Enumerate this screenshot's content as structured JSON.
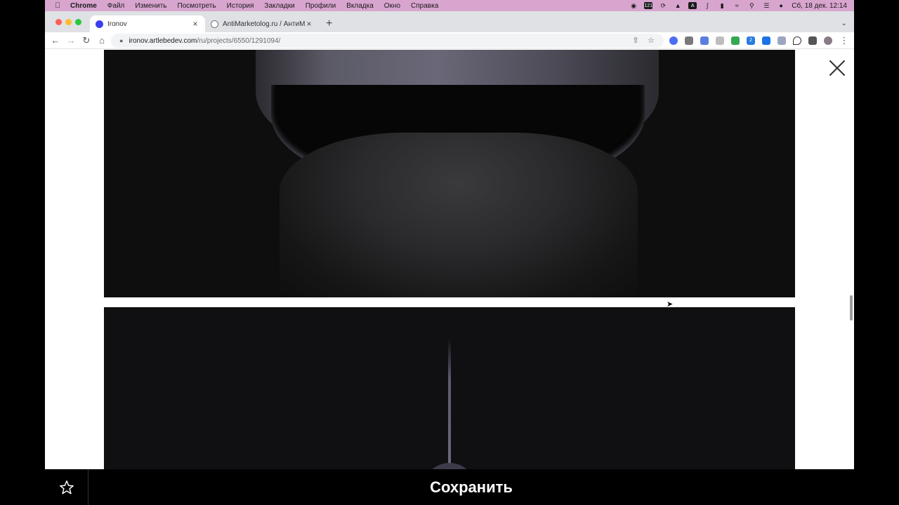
{
  "menubar": {
    "app": "Chrome",
    "items": [
      "Файл",
      "Изменить",
      "Посмотреть",
      "История",
      "Закладки",
      "Профили",
      "Вкладка",
      "Окно",
      "Справка"
    ],
    "badge": "121",
    "date_time": "Сб, 18 дек. 12:14"
  },
  "tabs": [
    {
      "title": "Ironov",
      "favicon_color": "#3b3ff0"
    },
    {
      "title": "AntiMarketolog.ru / АнтиМарке...",
      "favicon_color": "#777777"
    }
  ],
  "toolbar": {
    "url_host": "ironov.artlebedev.com",
    "url_path": "/ru/projects/6550/1291094/",
    "extension_badge": "2"
  },
  "bottom": {
    "save_label": "Сохранить"
  },
  "colors": {
    "menubar_bg": "#d8a5cf",
    "bottom_bg": "#000000"
  }
}
